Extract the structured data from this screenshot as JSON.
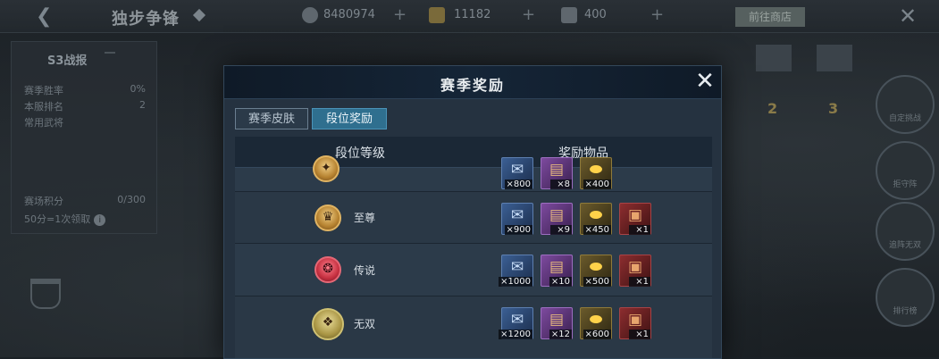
{
  "background": {
    "title": "独步争锋",
    "currencies": [
      {
        "icon": "coin-icon",
        "value": "8480974"
      },
      {
        "icon": "gold-ingot-icon",
        "value": "11182"
      },
      {
        "icon": "feather-icon",
        "value": "400"
      }
    ],
    "shop_label": "前往商店",
    "season_panel": {
      "title": "S3战报",
      "tag": "",
      "rows": [
        {
          "label": "赛季胜率",
          "value": "0%"
        },
        {
          "label": "本服排名",
          "value": "2"
        },
        {
          "label": "常用武将",
          "value": ""
        }
      ],
      "points_label": "赛场积分",
      "points_value": "0/300",
      "points_note": "50分=1次领取"
    },
    "right_labels": [
      "自定挑战",
      "拒守阵",
      "追阵无双",
      "排行榜"
    ],
    "player_ranks": [
      "2",
      "3"
    ]
  },
  "modal": {
    "title": "赛季奖励",
    "tabs": [
      {
        "label": "赛季皮肤",
        "active": false
      },
      {
        "label": "段位奖励",
        "active": true
      }
    ],
    "columns": {
      "tier": "段位等级",
      "rewards": "奖励物品"
    },
    "rows": [
      {
        "tier": "",
        "tier_icon": "gold-tier-badge-icon",
        "rewards": [
          "×800",
          "×8",
          "×400"
        ]
      },
      {
        "tier": "至尊",
        "tier_icon": "supreme-tier-badge-icon",
        "rewards": [
          "×900",
          "×9",
          "×450",
          "×1"
        ]
      },
      {
        "tier": "传说",
        "tier_icon": "legend-tier-badge-icon",
        "rewards": [
          "×1000",
          "×10",
          "×500",
          "×1"
        ]
      },
      {
        "tier": "无双",
        "tier_icon": "peerless-tier-badge-icon",
        "rewards": [
          "×1200",
          "×12",
          "×600",
          "×1"
        ]
      }
    ]
  }
}
